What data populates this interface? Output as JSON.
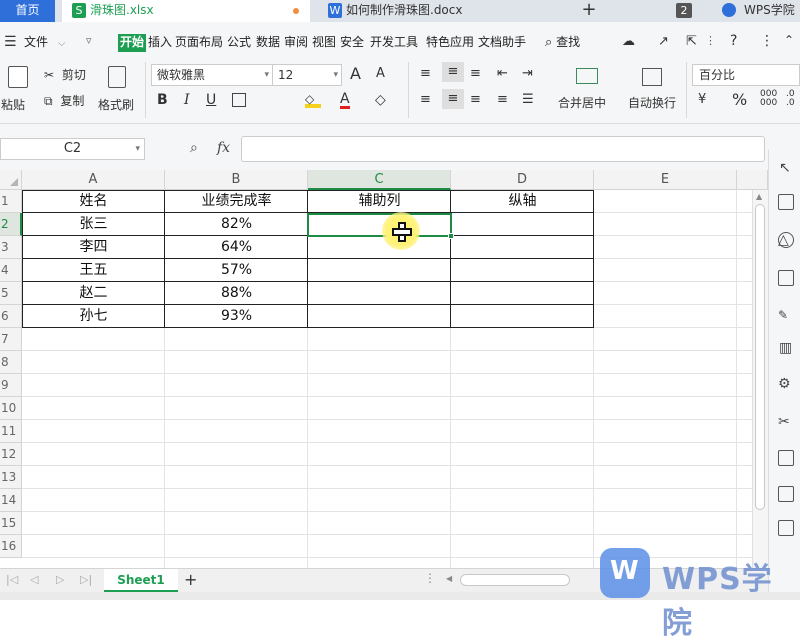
{
  "tabs": {
    "home": "首页",
    "xlsx": "滑珠图.xlsx",
    "docx": "如何制作滑珠图.docx",
    "new_tab": "+",
    "count": "2",
    "brand": "WPS学院"
  },
  "menu": {
    "file": "文件",
    "items": [
      "开始",
      "插入",
      "页面布局",
      "公式",
      "数据",
      "审阅",
      "视图",
      "安全",
      "开发工具",
      "特色应用",
      "文档助手"
    ],
    "search": "查找"
  },
  "ribbon": {
    "cut": "剪切",
    "paste": "粘贴",
    "copy": "复制",
    "format_painter": "格式刷",
    "font_name": "微软雅黑",
    "font_size": "12",
    "merge_center": "合并居中",
    "wrap_text": "自动换行",
    "number_format": "百分比",
    "percent_symbol": "%",
    "bold": "B",
    "italic": "I",
    "underline": "U",
    "grow_font": "A",
    "shrink_font": "A"
  },
  "formula_bar": {
    "name_box": "C2",
    "fx": "fx",
    "formula": ""
  },
  "sheet": {
    "columns": [
      "A",
      "B",
      "C",
      "D",
      "E"
    ],
    "rows": [
      "1",
      "2",
      "3",
      "4",
      "5",
      "6",
      "7",
      "8",
      "9",
      "10",
      "11",
      "12",
      "13",
      "14",
      "15",
      "16"
    ],
    "header": [
      "姓名",
      "业绩完成率",
      "辅助列",
      "纵轴"
    ],
    "data": [
      [
        "张三",
        "82%",
        "",
        ""
      ],
      [
        "李四",
        "64%",
        "",
        ""
      ],
      [
        "王五",
        "57%",
        "",
        ""
      ],
      [
        "赵二",
        "88%",
        "",
        ""
      ],
      [
        "孙七",
        "93%",
        "",
        ""
      ]
    ],
    "selected_cell": "C2"
  },
  "sheet_tabs": {
    "active": "Sheet1",
    "add": "+"
  },
  "watermark": "WPS学院",
  "colors": {
    "accent_green": "#1e9e53",
    "selection": "#1e8b44",
    "wps_blue": "#2f6fd9"
  }
}
